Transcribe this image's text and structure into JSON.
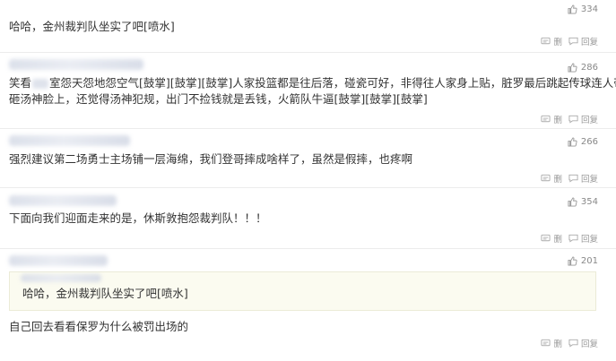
{
  "comments": [
    {
      "text": "哈哈，金州裁判队坐实了吧[喷水]",
      "likes": "334",
      "actions": {
        "delete": "删",
        "reply": "回复"
      }
    },
    {
      "text_line1_pre": "笑看",
      "text_line1_post": "室怨天怨地怨空气[鼓掌][鼓掌][鼓掌]人家投篮都是往后落，碰瓷可好，非得往人家身上贴，脏罗最后跳起传球连人带球",
      "text_line2": "砸汤神脸上，还觉得汤神犯规，出门不捡钱就是丢钱，火箭队牛逼[鼓掌][鼓掌][鼓掌]",
      "likes": "286",
      "actions": {
        "delete": "删",
        "reply": "回复"
      }
    },
    {
      "text": "强烈建议第二场勇士主场铺一层海绵，我们登哥摔成啥样了，虽然是假摔，也疼啊",
      "likes": "266",
      "actions": {
        "delete": "删",
        "reply": "回复"
      }
    },
    {
      "text": "下面向我们迎面走来的是，休斯敦抱怨裁判队！！！",
      "likes": "354",
      "actions": {
        "delete": "删",
        "reply": "回复"
      }
    },
    {
      "quote": "哈哈，金州裁判队坐实了吧[喷水]",
      "text": "自己回去看看保罗为什么被罚出场的",
      "likes": "201",
      "actions": {
        "delete": "删",
        "reply": "回复"
      }
    }
  ],
  "icons": {
    "like": "thumbs-up-icon",
    "delete": "delete-icon",
    "reply": "reply-icon"
  },
  "colors": {
    "text": "#333333",
    "meta": "#888888",
    "quote_bg": "#fbfbf0"
  }
}
